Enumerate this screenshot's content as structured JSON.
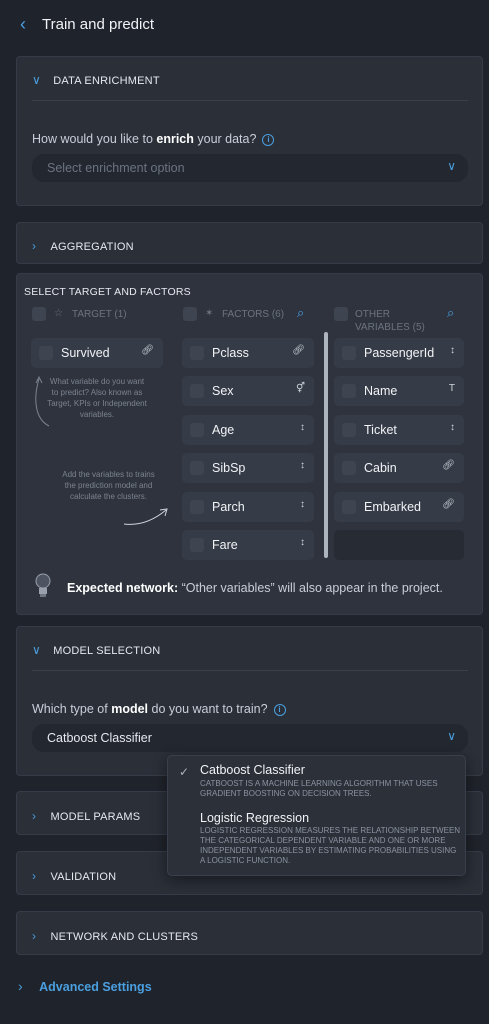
{
  "header": {
    "title": "Train and predict"
  },
  "data_enrichment": {
    "title": "DATA ENRICHMENT",
    "question_pre": "How would you like to ",
    "question_bold": "enrich",
    "question_post": " your data?",
    "placeholder": "Select enrichment option"
  },
  "aggregation": {
    "title": "AGGREGATION"
  },
  "targets": {
    "title": "SELECT TARGET AND FACTORS",
    "target_header": "TARGET (1)",
    "factors_header": "FACTORS (6)",
    "other_header_1": "OTHER",
    "other_header_2": "VARIABLES (5)",
    "target_items": [
      {
        "label": "Survived",
        "icon": "link-icon"
      }
    ],
    "factor_items": [
      {
        "label": "Pclass",
        "icon": "link-icon"
      },
      {
        "label": "Sex",
        "icon": "gender-icon"
      },
      {
        "label": "Age",
        "icon": "numeric-icon"
      },
      {
        "label": "SibSp",
        "icon": "numeric-icon"
      },
      {
        "label": "Parch",
        "icon": "numeric-icon"
      },
      {
        "label": "Fare",
        "icon": "numeric-icon"
      }
    ],
    "other_items": [
      {
        "label": "PassengerId",
        "icon": "numeric-icon"
      },
      {
        "label": "Name",
        "icon": "text-icon"
      },
      {
        "label": "Ticket",
        "icon": "numeric-icon"
      },
      {
        "label": "Cabin",
        "icon": "link-icon"
      },
      {
        "label": "Embarked",
        "icon": "link-icon"
      }
    ],
    "hint_1": "What variable do you want to predict? Also known as Target, KPIs or Independent variables.",
    "hint_2": "Add the variables to trains the prediction model and calculate the clusters.",
    "network_bold": "Expected network:",
    "network_text": " “Other variables” will also appear in the project."
  },
  "model_selection": {
    "title": "MODEL SELECTION",
    "question_pre": "Which type of ",
    "question_bold": "model",
    "question_post": " do you want to train?",
    "selected": "Catboost Classifier",
    "options": [
      {
        "title": "Catboost Classifier",
        "desc": "CATBOOST IS A MACHINE LEARNING ALGORITHM THAT USES GRADIENT BOOSTING ON DECISION TREES."
      },
      {
        "title": "Logistic Regression",
        "desc": "LOGISTIC REGRESSION MEASURES THE RELATIONSHIP BETWEEN THE CATEGORICAL DEPENDENT VARIABLE AND ONE OR MORE INDEPENDENT VARIABLES BY ESTIMATING PROBABILITIES USING A LOGISTIC FUNCTION."
      }
    ]
  },
  "model_params": {
    "title": "MODEL PARAMS"
  },
  "validation": {
    "title": "VALIDATION"
  },
  "network_clusters": {
    "title": "NETWORK AND CLUSTERS"
  },
  "advanced": {
    "label": "Advanced Settings"
  },
  "colors": {
    "accent": "#4a9fe0",
    "background": "#1f232b",
    "panel": "#2a2f38",
    "card": "#363c47"
  }
}
